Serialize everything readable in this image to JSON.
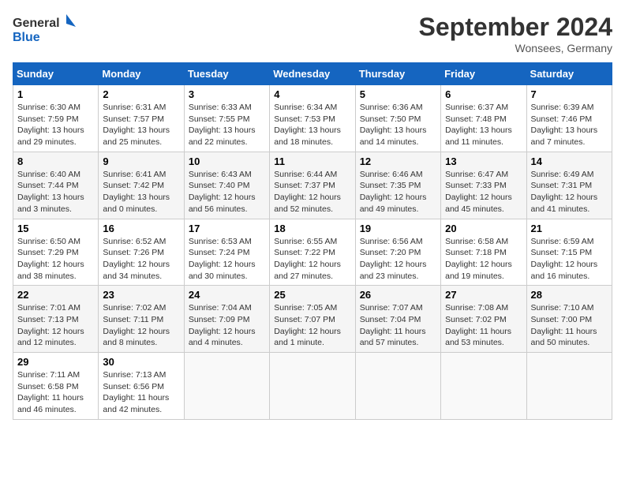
{
  "header": {
    "logo_general": "General",
    "logo_blue": "Blue",
    "month_title": "September 2024",
    "location": "Wonsees, Germany"
  },
  "weekdays": [
    "Sunday",
    "Monday",
    "Tuesday",
    "Wednesday",
    "Thursday",
    "Friday",
    "Saturday"
  ],
  "weeks": [
    [
      {
        "day": "1",
        "info": "Sunrise: 6:30 AM\nSunset: 7:59 PM\nDaylight: 13 hours\nand 29 minutes."
      },
      {
        "day": "2",
        "info": "Sunrise: 6:31 AM\nSunset: 7:57 PM\nDaylight: 13 hours\nand 25 minutes."
      },
      {
        "day": "3",
        "info": "Sunrise: 6:33 AM\nSunset: 7:55 PM\nDaylight: 13 hours\nand 22 minutes."
      },
      {
        "day": "4",
        "info": "Sunrise: 6:34 AM\nSunset: 7:53 PM\nDaylight: 13 hours\nand 18 minutes."
      },
      {
        "day": "5",
        "info": "Sunrise: 6:36 AM\nSunset: 7:50 PM\nDaylight: 13 hours\nand 14 minutes."
      },
      {
        "day": "6",
        "info": "Sunrise: 6:37 AM\nSunset: 7:48 PM\nDaylight: 13 hours\nand 11 minutes."
      },
      {
        "day": "7",
        "info": "Sunrise: 6:39 AM\nSunset: 7:46 PM\nDaylight: 13 hours\nand 7 minutes."
      }
    ],
    [
      {
        "day": "8",
        "info": "Sunrise: 6:40 AM\nSunset: 7:44 PM\nDaylight: 13 hours\nand 3 minutes."
      },
      {
        "day": "9",
        "info": "Sunrise: 6:41 AM\nSunset: 7:42 PM\nDaylight: 13 hours\nand 0 minutes."
      },
      {
        "day": "10",
        "info": "Sunrise: 6:43 AM\nSunset: 7:40 PM\nDaylight: 12 hours\nand 56 minutes."
      },
      {
        "day": "11",
        "info": "Sunrise: 6:44 AM\nSunset: 7:37 PM\nDaylight: 12 hours\nand 52 minutes."
      },
      {
        "day": "12",
        "info": "Sunrise: 6:46 AM\nSunset: 7:35 PM\nDaylight: 12 hours\nand 49 minutes."
      },
      {
        "day": "13",
        "info": "Sunrise: 6:47 AM\nSunset: 7:33 PM\nDaylight: 12 hours\nand 45 minutes."
      },
      {
        "day": "14",
        "info": "Sunrise: 6:49 AM\nSunset: 7:31 PM\nDaylight: 12 hours\nand 41 minutes."
      }
    ],
    [
      {
        "day": "15",
        "info": "Sunrise: 6:50 AM\nSunset: 7:29 PM\nDaylight: 12 hours\nand 38 minutes."
      },
      {
        "day": "16",
        "info": "Sunrise: 6:52 AM\nSunset: 7:26 PM\nDaylight: 12 hours\nand 34 minutes."
      },
      {
        "day": "17",
        "info": "Sunrise: 6:53 AM\nSunset: 7:24 PM\nDaylight: 12 hours\nand 30 minutes."
      },
      {
        "day": "18",
        "info": "Sunrise: 6:55 AM\nSunset: 7:22 PM\nDaylight: 12 hours\nand 27 minutes."
      },
      {
        "day": "19",
        "info": "Sunrise: 6:56 AM\nSunset: 7:20 PM\nDaylight: 12 hours\nand 23 minutes."
      },
      {
        "day": "20",
        "info": "Sunrise: 6:58 AM\nSunset: 7:18 PM\nDaylight: 12 hours\nand 19 minutes."
      },
      {
        "day": "21",
        "info": "Sunrise: 6:59 AM\nSunset: 7:15 PM\nDaylight: 12 hours\nand 16 minutes."
      }
    ],
    [
      {
        "day": "22",
        "info": "Sunrise: 7:01 AM\nSunset: 7:13 PM\nDaylight: 12 hours\nand 12 minutes."
      },
      {
        "day": "23",
        "info": "Sunrise: 7:02 AM\nSunset: 7:11 PM\nDaylight: 12 hours\nand 8 minutes."
      },
      {
        "day": "24",
        "info": "Sunrise: 7:04 AM\nSunset: 7:09 PM\nDaylight: 12 hours\nand 4 minutes."
      },
      {
        "day": "25",
        "info": "Sunrise: 7:05 AM\nSunset: 7:07 PM\nDaylight: 12 hours\nand 1 minute."
      },
      {
        "day": "26",
        "info": "Sunrise: 7:07 AM\nSunset: 7:04 PM\nDaylight: 11 hours\nand 57 minutes."
      },
      {
        "day": "27",
        "info": "Sunrise: 7:08 AM\nSunset: 7:02 PM\nDaylight: 11 hours\nand 53 minutes."
      },
      {
        "day": "28",
        "info": "Sunrise: 7:10 AM\nSunset: 7:00 PM\nDaylight: 11 hours\nand 50 minutes."
      }
    ],
    [
      {
        "day": "29",
        "info": "Sunrise: 7:11 AM\nSunset: 6:58 PM\nDaylight: 11 hours\nand 46 minutes."
      },
      {
        "day": "30",
        "info": "Sunrise: 7:13 AM\nSunset: 6:56 PM\nDaylight: 11 hours\nand 42 minutes."
      },
      {
        "day": "",
        "info": ""
      },
      {
        "day": "",
        "info": ""
      },
      {
        "day": "",
        "info": ""
      },
      {
        "day": "",
        "info": ""
      },
      {
        "day": "",
        "info": ""
      }
    ]
  ]
}
